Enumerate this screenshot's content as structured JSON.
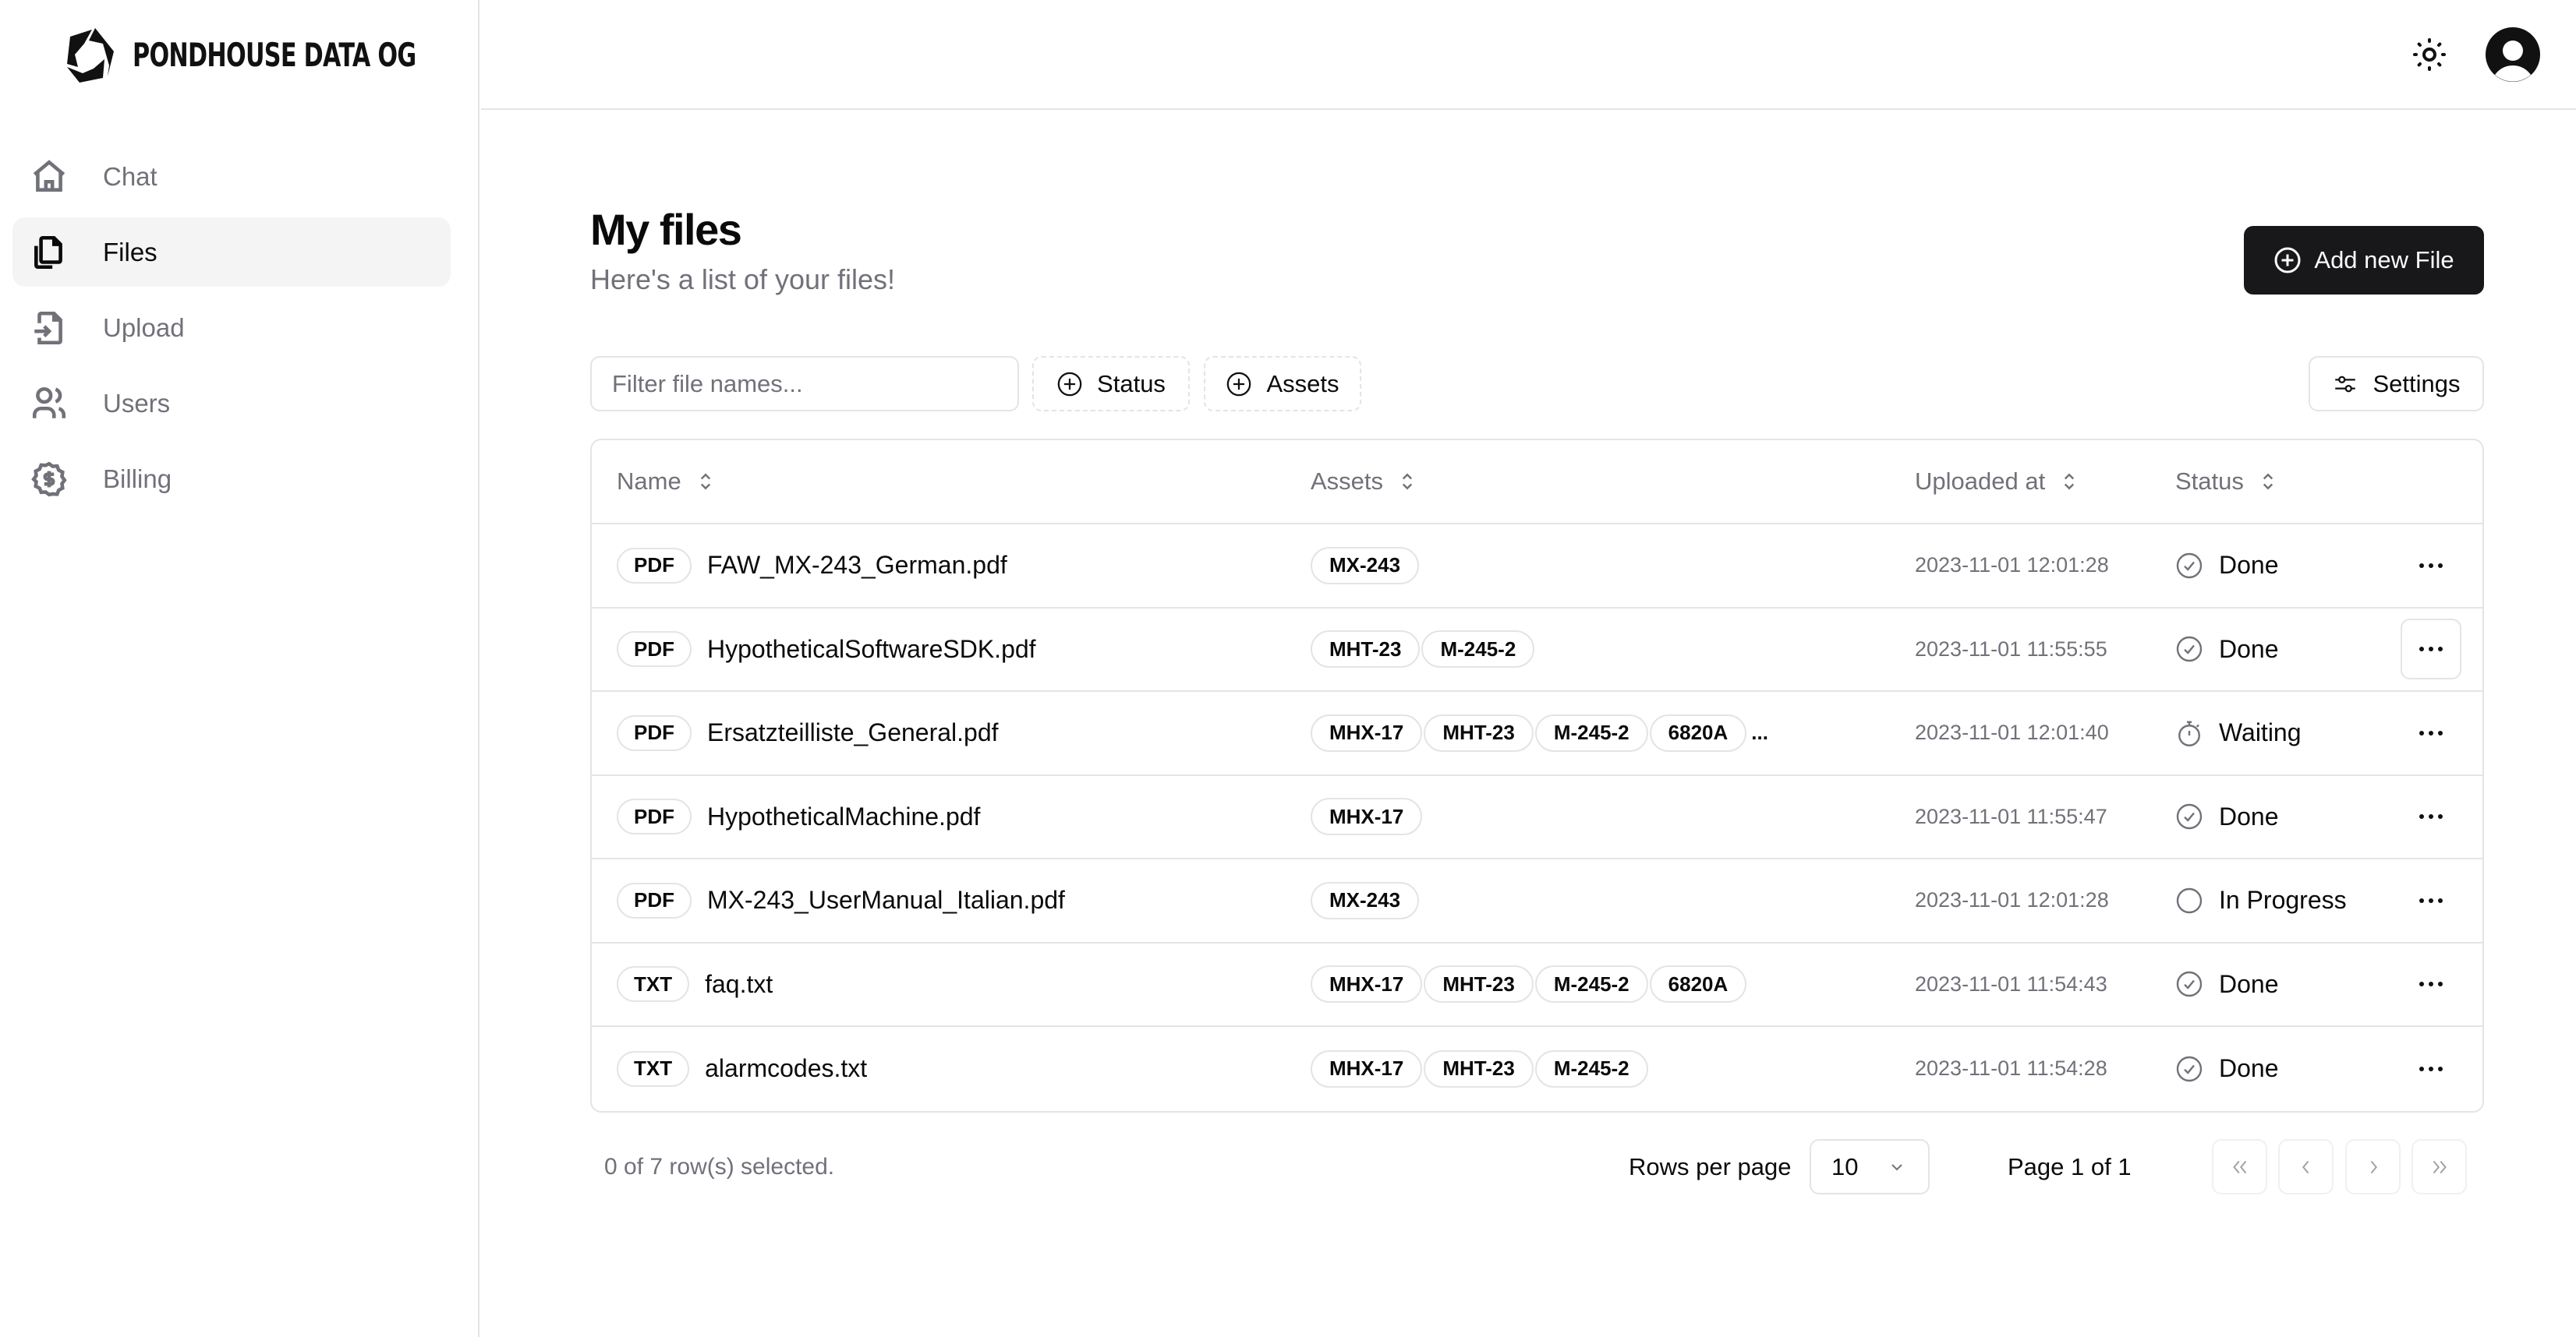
{
  "brand": {
    "name": "PONDHOUSE DATA OG"
  },
  "sidebar": {
    "items": [
      {
        "label": "Chat",
        "icon": "home-icon",
        "active": false
      },
      {
        "label": "Files",
        "icon": "files-icon",
        "active": true
      },
      {
        "label": "Upload",
        "icon": "file-import-icon",
        "active": false
      },
      {
        "label": "Users",
        "icon": "users-icon",
        "active": false
      },
      {
        "label": "Billing",
        "icon": "dollar-badge-icon",
        "active": false
      }
    ]
  },
  "topbar": {
    "theme_icon": "sun-icon",
    "avatar_icon": "user-circle-icon"
  },
  "page": {
    "title": "My files",
    "subtitle": "Here's a list of your files!",
    "add_button": "Add new File"
  },
  "toolbar": {
    "filter_placeholder": "Filter file names...",
    "filter_value": "",
    "status_filter": "Status",
    "assets_filter": "Assets",
    "settings": "Settings"
  },
  "table": {
    "columns": [
      "Name",
      "Assets",
      "Uploaded at",
      "Status"
    ],
    "rows": [
      {
        "type": "PDF",
        "name": "FAW_MX-243_German.pdf",
        "assets": [
          "MX-243"
        ],
        "more": "",
        "uploaded": "2023-11-01 12:01:28",
        "status": "Done"
      },
      {
        "type": "PDF",
        "name": "HypotheticalSoftwareSDK.pdf",
        "assets": [
          "MHT-23",
          "M-245-2"
        ],
        "more": "",
        "uploaded": "2023-11-01 11:55:55",
        "status": "Done"
      },
      {
        "type": "PDF",
        "name": "Ersatzteilliste_General.pdf",
        "assets": [
          "MHX-17",
          "MHT-23",
          "M-245-2",
          "6820A"
        ],
        "more": "...",
        "uploaded": "2023-11-01 12:01:40",
        "status": "Waiting"
      },
      {
        "type": "PDF",
        "name": "HypotheticalMachine.pdf",
        "assets": [
          "MHX-17"
        ],
        "more": "",
        "uploaded": "2023-11-01 11:55:47",
        "status": "Done"
      },
      {
        "type": "PDF",
        "name": "MX-243_UserManual_Italian.pdf",
        "assets": [
          "MX-243"
        ],
        "more": "",
        "uploaded": "2023-11-01 12:01:28",
        "status": "In Progress"
      },
      {
        "type": "TXT",
        "name": "faq.txt",
        "assets": [
          "MHX-17",
          "MHT-23",
          "M-245-2",
          "6820A"
        ],
        "more": "",
        "uploaded": "2023-11-01 11:54:43",
        "status": "Done"
      },
      {
        "type": "TXT",
        "name": "alarmcodes.txt",
        "assets": [
          "MHX-17",
          "MHT-23",
          "M-245-2"
        ],
        "more": "",
        "uploaded": "2023-11-01 11:54:28",
        "status": "Done"
      }
    ]
  },
  "footer": {
    "selection": "0 of 7 row(s) selected.",
    "rows_per_page_label": "Rows per page",
    "rows_per_page_value": "10",
    "page_info": "Page 1 of 1"
  },
  "colors": {
    "primary": "#18181b",
    "muted": "#71717a",
    "border": "#e4e4e7",
    "active_bg": "#f4f4f5"
  }
}
